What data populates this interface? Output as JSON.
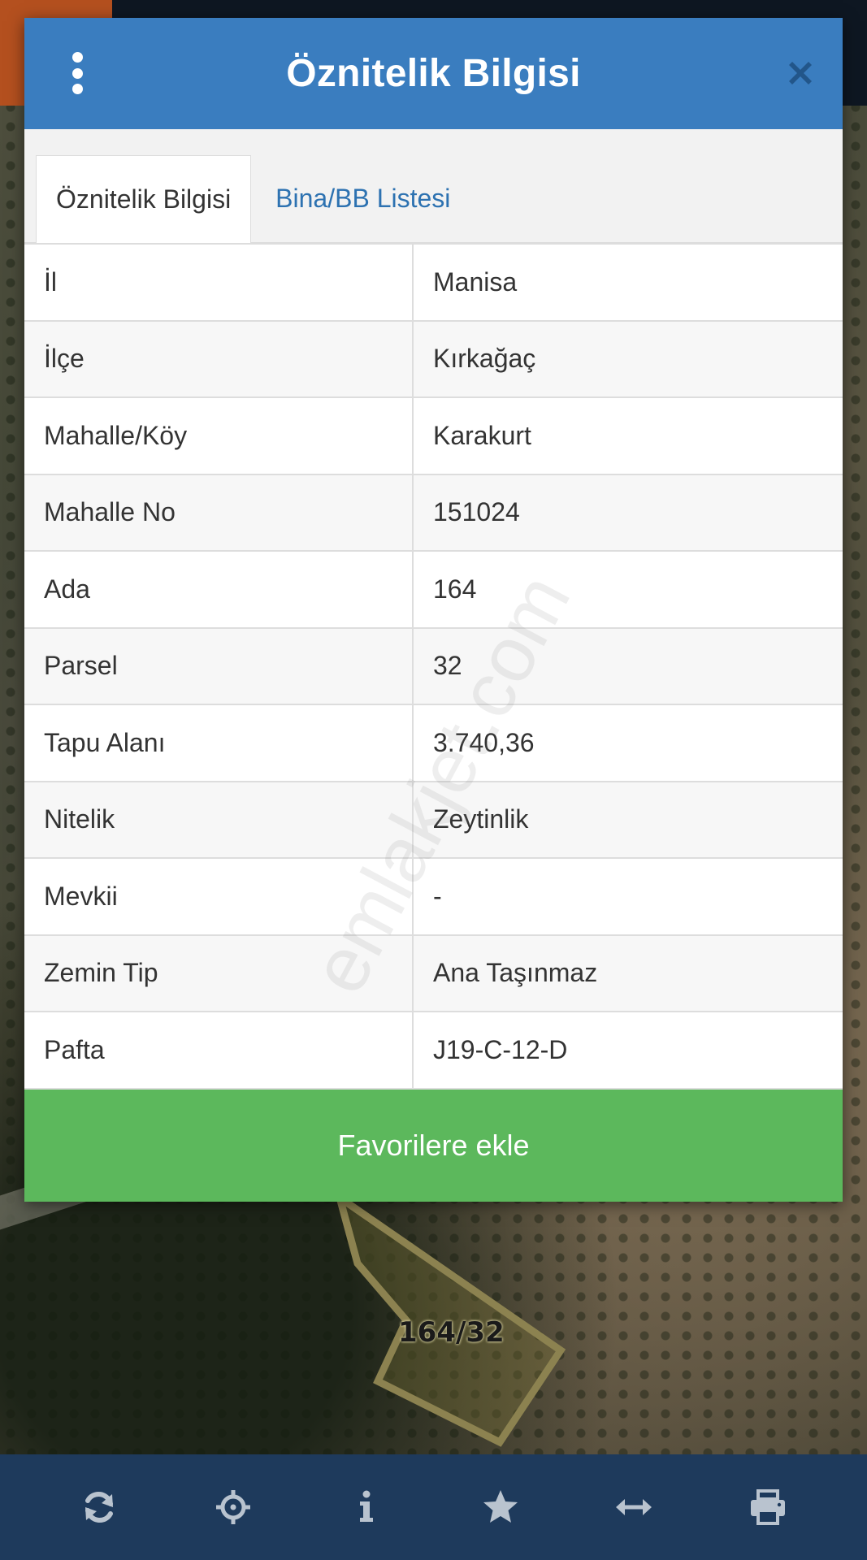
{
  "map": {
    "parcel_label": "164/32"
  },
  "dialog": {
    "title": "Öznitelik Bilgisi",
    "tabs": [
      {
        "label": "Öznitelik Bilgisi",
        "active": true
      },
      {
        "label": "Bina/BB Listesi",
        "active": false
      }
    ],
    "rows": [
      {
        "key": "İl",
        "value": "Manisa"
      },
      {
        "key": "İlçe",
        "value": "Kırkağaç"
      },
      {
        "key": "Mahalle/Köy",
        "value": "Karakurt"
      },
      {
        "key": "Mahalle No",
        "value": "151024"
      },
      {
        "key": "Ada",
        "value": "164"
      },
      {
        "key": "Parsel",
        "value": "32"
      },
      {
        "key": "Tapu Alanı",
        "value": "3.740,36"
      },
      {
        "key": "Nitelik",
        "value": "Zeytinlik"
      },
      {
        "key": "Mevkii",
        "value": "-"
      },
      {
        "key": "Zemin Tip",
        "value": "Ana Taşınmaz"
      },
      {
        "key": "Pafta",
        "value": "J19-C-12-D"
      }
    ],
    "favorite_button": "Favorilere ekle",
    "watermark": "emlakjet.com"
  },
  "toolbar": {
    "icons": [
      "refresh-icon",
      "crosshair-icon",
      "info-icon",
      "star-icon",
      "horizontal-arrows-icon",
      "printer-icon"
    ]
  },
  "colors": {
    "header_blue": "#3a7dbf",
    "tab_link_blue": "#2d72b1",
    "favorite_green": "#5cb85c",
    "toolbar_navy": "#1e3a5c",
    "toolbar_icon": "#b9c3cf"
  }
}
